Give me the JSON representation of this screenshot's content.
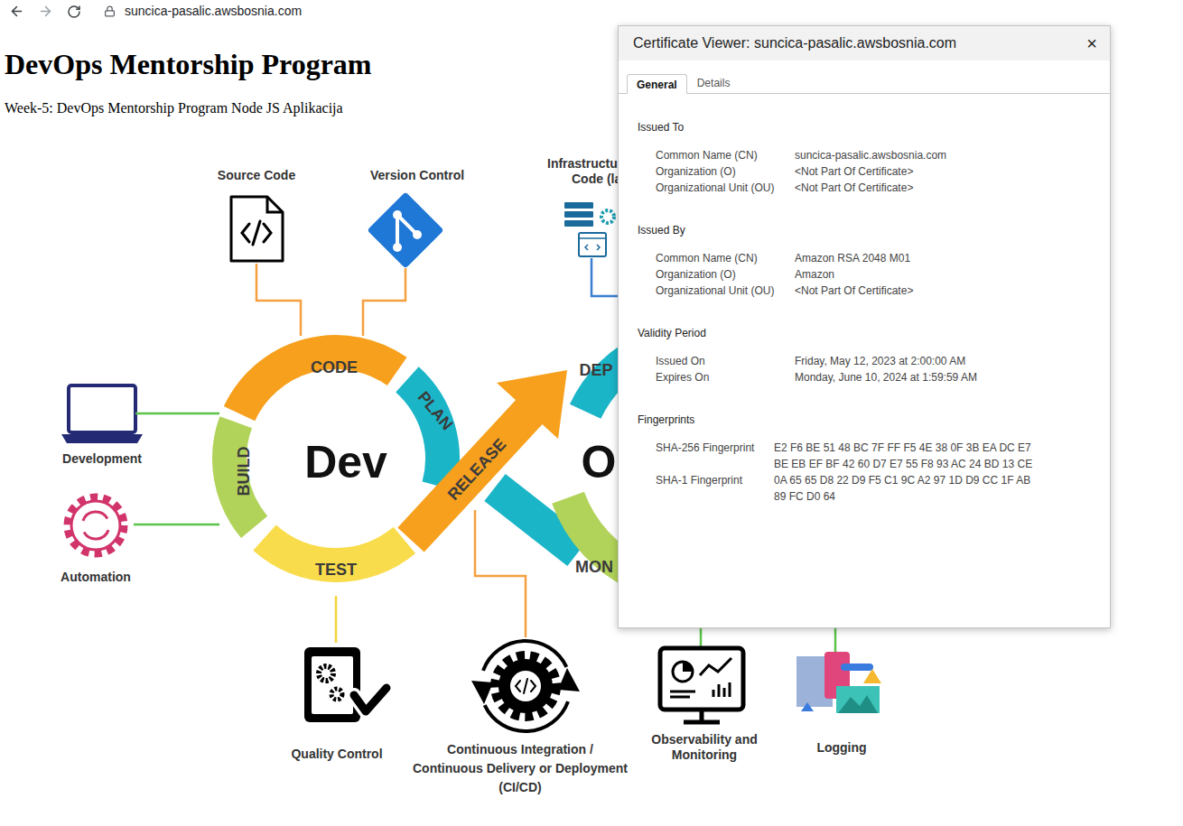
{
  "browser": {
    "url": "suncica-pasalic.awsbosnia.com"
  },
  "page": {
    "title": "DevOps Mentorship Program",
    "subtitle": "Week-5: DevOps Mentorship Program Node JS Aplikacija"
  },
  "diagram": {
    "centers": [
      "Dev",
      "O"
    ],
    "loop": [
      {
        "label": "CODE",
        "color": "#f7a01d"
      },
      {
        "label": "PLAN",
        "color": "#1bb5c8"
      },
      {
        "label": "BUILD",
        "color": "#b2d35a"
      },
      {
        "label": "TEST",
        "color": "#f9dc4b"
      },
      {
        "label": "RELEASE",
        "color": "#f7a01d"
      },
      {
        "label": "DEP",
        "color": "#1bb5c8"
      },
      {
        "label": "MON",
        "color": "#b2d35a"
      }
    ],
    "nodes": [
      {
        "kind": "code-file",
        "lines": [
          "Source Code"
        ]
      },
      {
        "kind": "git",
        "lines": [
          "Version Control"
        ]
      },
      {
        "kind": "iac",
        "lines": [
          "Infrastructur",
          "Code (la"
        ]
      },
      {
        "kind": "laptop",
        "lines": [
          "Development"
        ]
      },
      {
        "kind": "automation",
        "lines": [
          "Automation"
        ]
      },
      {
        "kind": "quality",
        "lines": [
          "Quality Control"
        ]
      },
      {
        "kind": "cicd",
        "lines": [
          "Continuous Integration /",
          "Continuous Delivery or Deployment",
          "(CI/CD)"
        ]
      },
      {
        "kind": "monitor",
        "lines": [
          "Observability and",
          "Monitoring"
        ]
      },
      {
        "kind": "logging",
        "lines": [
          "Logging"
        ]
      }
    ]
  },
  "certificate_viewer": {
    "title": "Certificate Viewer: suncica-pasalic.awsbosnia.com",
    "close": "×",
    "tabs": [
      {
        "label": "General",
        "selected": true
      },
      {
        "label": "Details",
        "selected": false
      }
    ],
    "sections": [
      {
        "heading": "Issued To",
        "rows": [
          {
            "label": "Common Name (CN)",
            "lines": [
              "suncica-pasalic.awsbosnia.com"
            ]
          },
          {
            "label": "Organization (O)",
            "lines": [
              "<Not Part Of Certificate>"
            ]
          },
          {
            "label": "Organizational Unit (OU)",
            "lines": [
              "<Not Part Of Certificate>"
            ]
          }
        ]
      },
      {
        "heading": "Issued By",
        "rows": [
          {
            "label": "Common Name (CN)",
            "lines": [
              "Amazon RSA 2048 M01"
            ]
          },
          {
            "label": "Organization (O)",
            "lines": [
              "Amazon"
            ]
          },
          {
            "label": "Organizational Unit (OU)",
            "lines": [
              "<Not Part Of Certificate>"
            ]
          }
        ]
      },
      {
        "heading": "Validity Period",
        "rows": [
          {
            "label": "Issued On",
            "lines": [
              "Friday, May 12, 2023 at 2:00:00 AM"
            ]
          },
          {
            "label": "Expires On",
            "lines": [
              "Monday, June 10, 2024 at 1:59:59 AM"
            ]
          }
        ]
      },
      {
        "heading": "Fingerprints",
        "rows": [
          {
            "label": "SHA-256 Fingerprint",
            "lines": [
              "E2 F6 BE 51 48 BC 7F FF F5 4E 38 0F 3B EA DC E7",
              "BE EB EF BF 42 60 D7 E7 55 F8 93 AC 24 BD 13 CE"
            ]
          },
          {
            "label": "SHA-1 Fingerprint",
            "lines": [
              "0A 65 65 D8 22 D9 F5 C1 9C A2 97 1D D9 CC 1F AB",
              "89 FC D0 64"
            ]
          }
        ]
      }
    ]
  }
}
